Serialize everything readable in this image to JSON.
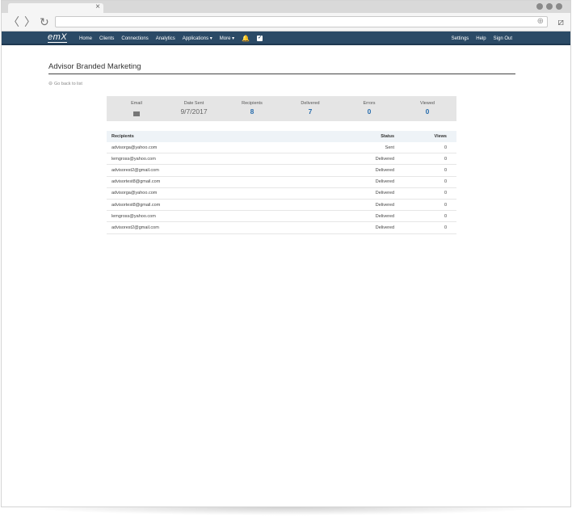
{
  "browser": {
    "tab_close": "×",
    "back": "〈",
    "forward": "〉",
    "reload": "↻",
    "globe": "⊕",
    "extension": "⧄"
  },
  "nav": {
    "logo": "emX",
    "items": [
      "Home",
      "Clients",
      "Connections",
      "Analytics",
      "Applications ▾",
      "More ▾"
    ],
    "right_items": [
      "Settings",
      "Help",
      "Sign Out"
    ],
    "bell": "🔔",
    "check": "✓"
  },
  "page": {
    "title": "Advisor Branded Marketing",
    "back_link": "Go back to list"
  },
  "stats": {
    "email_label": "Email",
    "date_label": "Date Sent",
    "date_value": "9/7/2017",
    "recipients_label": "Recipients",
    "recipients_value": "8",
    "delivered_label": "Delivered",
    "delivered_value": "7",
    "errors_label": "Errors",
    "errors_value": "0",
    "viewed_label": "Viewed",
    "viewed_value": "0"
  },
  "table": {
    "headers": {
      "recipients": "Recipients",
      "status": "Status",
      "views": "Views"
    },
    "rows": [
      {
        "email": "advisorga@yahoo.com",
        "status": "Sent",
        "views": "0"
      },
      {
        "email": "lemgross@yahoo.com",
        "status": "Delivered",
        "views": "0"
      },
      {
        "email": "advisorest2@gmail.com",
        "status": "Delivered",
        "views": "0"
      },
      {
        "email": "advisortest8@gmail.com",
        "status": "Delivered",
        "views": "0"
      },
      {
        "email": "advisorga@yahoo.com",
        "status": "Delivered",
        "views": "0"
      },
      {
        "email": "advisortest8@gmail.com",
        "status": "Delivered",
        "views": "0"
      },
      {
        "email": "lemgross@yahoo.com",
        "status": "Delivered",
        "views": "0"
      },
      {
        "email": "advisorest2@gmail.com",
        "status": "Delivered",
        "views": "0"
      }
    ]
  },
  "colors": {
    "navbar": "#2b4a66",
    "link_blue": "#2a6ead",
    "stats_bg": "#e5e5e5"
  }
}
